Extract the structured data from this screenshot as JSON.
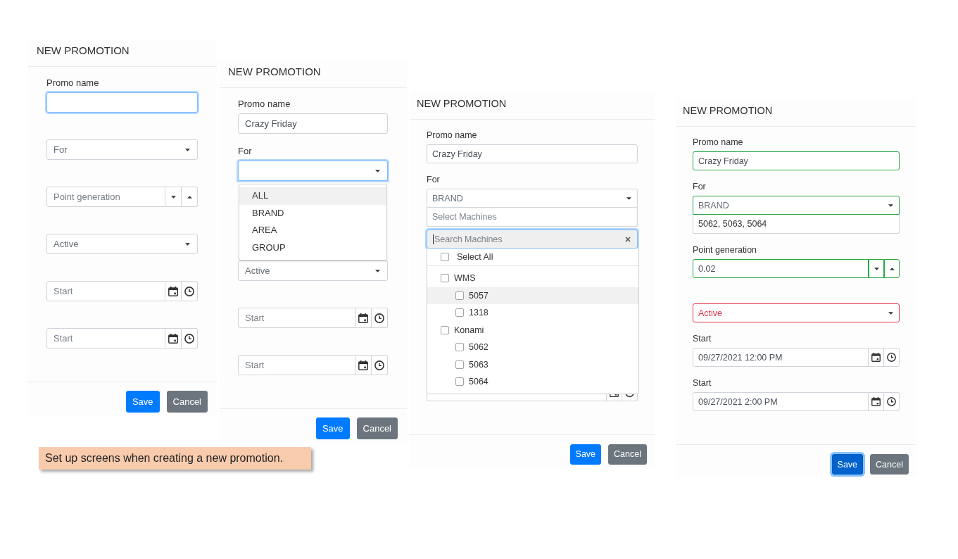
{
  "panels": [
    {
      "title": "NEW PROMOTION",
      "fields": [
        {
          "kind": "text",
          "label": "Promo name",
          "focused": true
        },
        {
          "kind": "select",
          "placeholder": "For",
          "focused": false
        },
        {
          "kind": "spinner",
          "placeholder": "Point generation",
          "focused": false
        },
        {
          "kind": "select",
          "placeholder": "Active",
          "focused": false
        },
        {
          "kind": "datetime",
          "placeholder": "Start",
          "focused": false
        },
        {
          "kind": "datetime",
          "placeholder": "Start",
          "focused": false
        }
      ],
      "buttons": [
        {
          "kind": "primary",
          "label": "Save",
          "focused": false
        },
        {
          "kind": "secondary",
          "label": "Cancel",
          "focused": false
        }
      ]
    },
    {
      "title": "NEW PROMOTION",
      "fields": [
        {
          "kind": "text",
          "label": "Promo name",
          "value": "Crazy Friday",
          "focused": false
        },
        {
          "kind": "select",
          "label": "For",
          "focused": true,
          "expanded": true,
          "options": [
            {
              "label": "ALL",
              "highlighted": true
            },
            {
              "label": "BRAND",
              "highlighted": false
            },
            {
              "label": "AREA",
              "highlighted": false
            },
            {
              "label": "GROUP",
              "highlighted": false
            }
          ]
        },
        {
          "kind": "select",
          "placeholder": "Active",
          "focused": false
        },
        {
          "kind": "datetime",
          "placeholder": "Start",
          "focused": false
        },
        {
          "kind": "datetime",
          "placeholder": "Start",
          "focused": false
        }
      ],
      "buttons": [
        {
          "kind": "primary",
          "label": "Save",
          "focused": false
        },
        {
          "kind": "secondary",
          "label": "Cancel",
          "focused": false
        }
      ]
    },
    {
      "title": "NEW PROMOTION",
      "fields": [
        {
          "kind": "text",
          "label": "Promo name",
          "value": "Crazy Friday",
          "focused": false
        },
        {
          "kind": "select",
          "label": "For",
          "value": "BRAND",
          "focused": false,
          "machines": {
            "placeholder": "Select Machines",
            "expanded": true,
            "search": {
              "placeholder": "Search Machines",
              "focused": true
            },
            "select_all": {
              "label": "Select All",
              "checked": false
            },
            "groups": [
              {
                "label": "WMS",
                "checked": false,
                "highlighted": false,
                "children": [
                  {
                    "label": "5057",
                    "checked": false,
                    "highlighted": true
                  },
                  {
                    "label": "1318",
                    "checked": false,
                    "highlighted": false
                  }
                ]
              },
              {
                "label": "Konami",
                "checked": false,
                "highlighted": false,
                "children": [
                  {
                    "label": "5062",
                    "checked": false,
                    "highlighted": false
                  },
                  {
                    "label": "5063",
                    "checked": false,
                    "highlighted": false
                  },
                  {
                    "label": "5064",
                    "checked": false,
                    "highlighted": false
                  }
                ]
              }
            ]
          }
        },
        {
          "kind": "datetime",
          "focused": false
        }
      ],
      "buttons": [
        {
          "kind": "primary",
          "label": "Save",
          "focused": false
        },
        {
          "kind": "secondary",
          "label": "Cancel",
          "focused": false
        }
      ]
    },
    {
      "title": "NEW PROMOTION",
      "fields": [
        {
          "kind": "text",
          "label": "Promo name",
          "value": "Crazy Friday",
          "focused": false,
          "valid": true
        },
        {
          "kind": "select",
          "label": "For",
          "value": "BRAND",
          "focused": false,
          "valid": true,
          "machines": {
            "value": "5062, 5063, 5064",
            "expanded": false
          }
        },
        {
          "kind": "spinner",
          "label": "Point generation",
          "value": "0.02",
          "focused": false,
          "valid": true
        },
        {
          "kind": "select",
          "placeholder": "Active",
          "focused": false,
          "valid": false
        },
        {
          "kind": "datetime",
          "label": "Start",
          "value": "09/27/2021 12:00 PM",
          "focused": false
        },
        {
          "kind": "datetime",
          "label": "Start",
          "value": "09/27/2021 2:00 PM",
          "focused": false
        }
      ],
      "buttons": [
        {
          "kind": "primary",
          "label": "Save",
          "focused": true
        },
        {
          "kind": "secondary",
          "label": "Cancel",
          "focused": false
        }
      ]
    }
  ],
  "note": "Set up screens when creating a new promotion."
}
